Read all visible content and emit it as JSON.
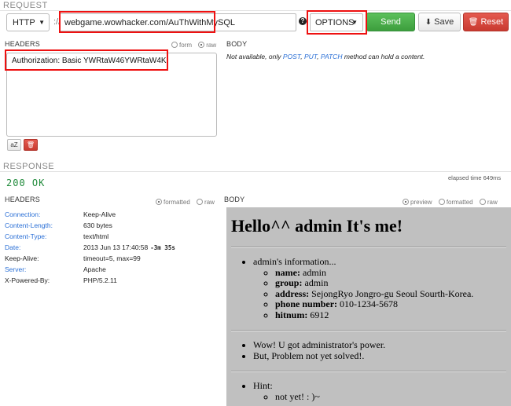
{
  "request": {
    "section_label": "REQUEST",
    "protocol": "HTTP",
    "separator": "://",
    "url": "webgame.wowhacker.com/AuThWithMySQL",
    "help_icon": "?",
    "method": "OPTIONS",
    "send_label": "Send",
    "save_label": "Save",
    "reset_label": "Reset",
    "headers_label": "HEADERS",
    "headers_mode_options": [
      "form",
      "raw"
    ],
    "headers_mode_selected": "raw",
    "headers_text": "Authorization: Basic YWRtaW46YWRtaW4K",
    "az_label": "aZ",
    "body_label": "BODY",
    "body_note_prefix": "Not available, only ",
    "body_note_methods": [
      "POST",
      "PUT",
      "PATCH"
    ],
    "body_note_sep1": ", ",
    "body_note_sep2": ", ",
    "body_note_suffix": " method can hold a content."
  },
  "response": {
    "section_label": "RESPONSE",
    "status": "200 OK",
    "elapsed": "elapsed time 649ms",
    "headers_label": "HEADERS",
    "headers_view_options": [
      "formatted",
      "raw"
    ],
    "headers_view_selected": "formatted",
    "headers": [
      {
        "key": "Connection:",
        "value": "Keep-Alive",
        "extra": "",
        "link": true
      },
      {
        "key": "Content-Length:",
        "value": "630 bytes",
        "extra": "",
        "link": true
      },
      {
        "key": "Content-Type:",
        "value": "text/html",
        "extra": "",
        "link": true
      },
      {
        "key": "Date:",
        "value": "2013 Jun 13 17:40:58",
        "extra": "-3m 35s",
        "link": true
      },
      {
        "key": "Keep-Alive:",
        "value": "timeout=5, max=99",
        "extra": "",
        "link": false
      },
      {
        "key": "Server:",
        "value": "Apache",
        "extra": "",
        "link": true
      },
      {
        "key": "X-Powered-By:",
        "value": "PHP/5.2.11",
        "extra": "",
        "link": false
      }
    ],
    "body_label": "BODY",
    "body_view_options": [
      "preview",
      "formatted",
      "raw"
    ],
    "body_view_selected": "preview",
    "preview": {
      "title": "Hello^^ admin It's me!",
      "info_heading": "admin's information...",
      "info": [
        {
          "k": "name:",
          "v": " admin"
        },
        {
          "k": "group:",
          "v": " admin"
        },
        {
          "k": "address:",
          "v": " SejongRyo Jongro-gu Seoul Sourth-Korea."
        },
        {
          "k": "phone number:",
          "v": " 010-1234-5678"
        },
        {
          "k": "hitnum:",
          "v": " 6912"
        }
      ],
      "messages": [
        "Wow! U got administrator's power.",
        "But, Problem not yet solved!."
      ],
      "hint_heading": "Hint:",
      "hints": [
        "not yet! : )~"
      ]
    }
  },
  "colors": {
    "send": "#4caf50",
    "reset": "#d9453b",
    "highlight": "#ee1111",
    "link": "#2a6fd6",
    "status": "#1f8a3a",
    "preview_bg": "#c0c0c0"
  },
  "icons": {
    "save": "download-icon",
    "reset": "trash-icon",
    "help": "question-circle-icon"
  }
}
